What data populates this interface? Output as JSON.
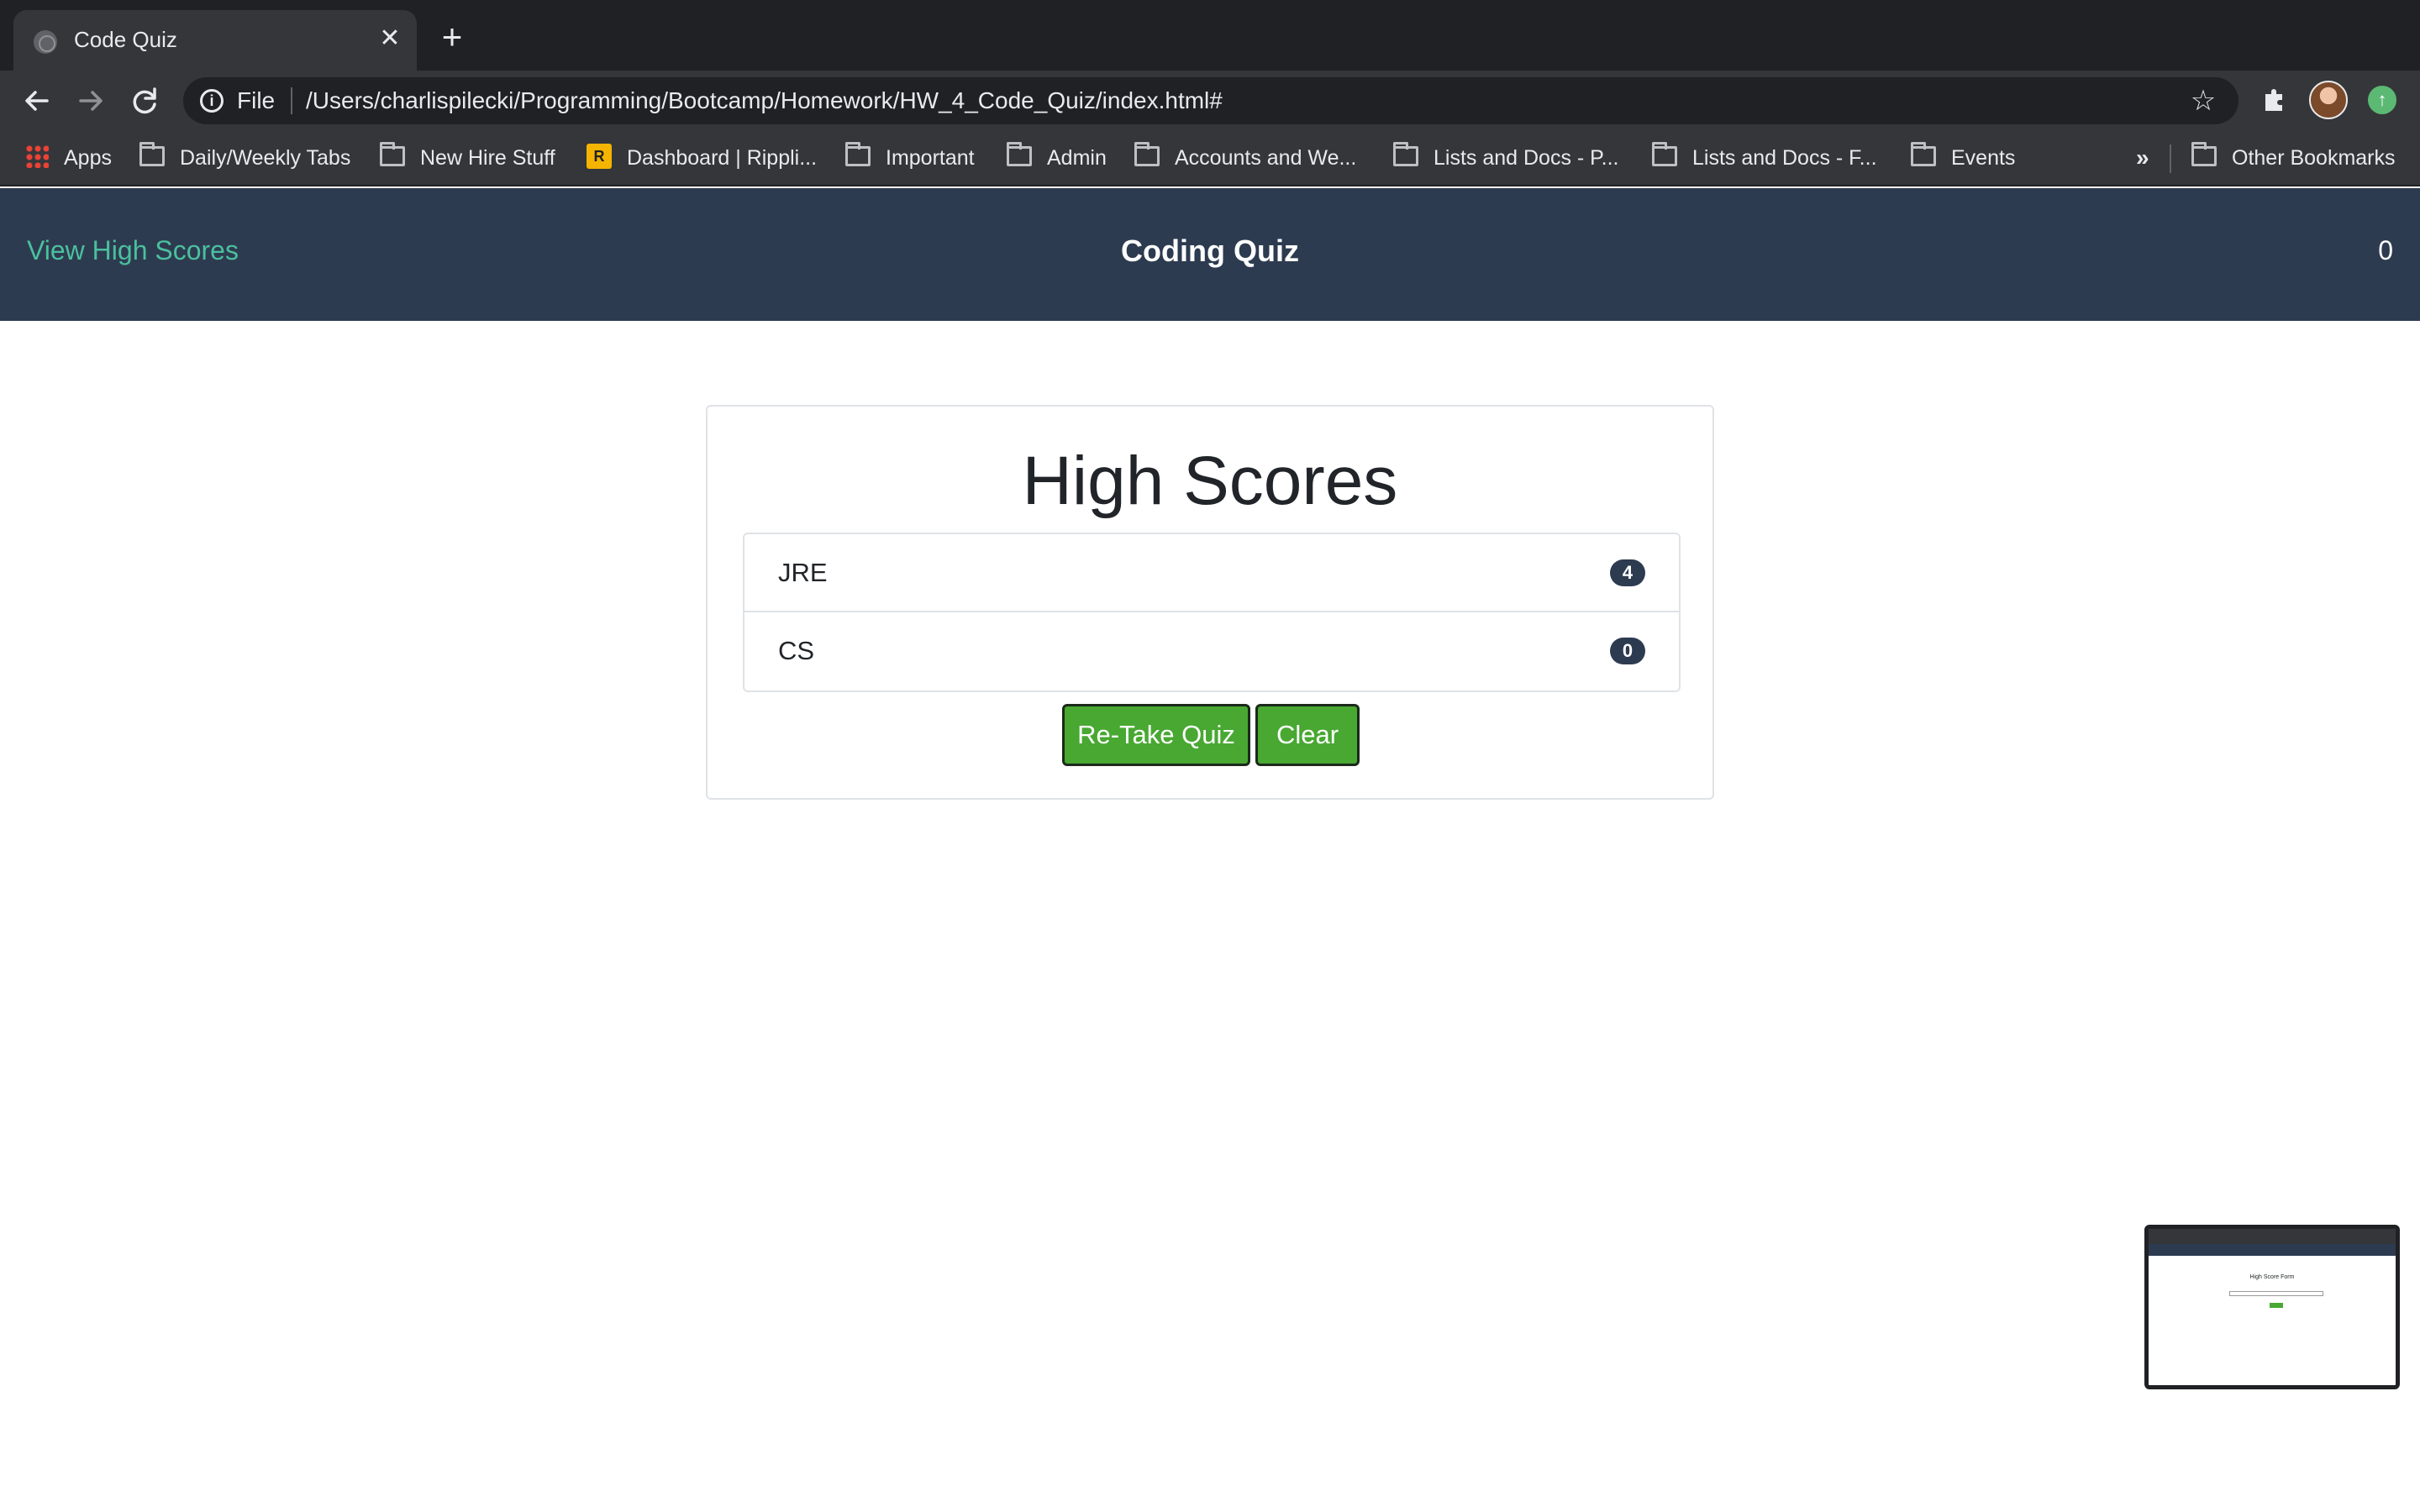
{
  "browser": {
    "tab_title": "Code Quiz",
    "tab_close": "✕",
    "new_tab": "+",
    "file_label": "File",
    "url": "/Users/charlispilecki/Programming/Bootcamp/Homework/HW_4_Code_Quiz/index.html#",
    "bookmarks": [
      "Apps",
      "Daily/Weekly Tabs",
      "New Hire Stuff",
      "Dashboard | Rippli...",
      "Important",
      "Admin",
      "Accounts and We...",
      "Lists and Docs - P...",
      "Lists and Docs - F...",
      "Events"
    ],
    "more_bookmarks": "»",
    "other_bookmarks": "Other Bookmarks"
  },
  "header": {
    "view_high_scores": "View High Scores",
    "title": "Coding Quiz",
    "timer": "0"
  },
  "high_scores": {
    "title": "High Scores",
    "entries": [
      {
        "name": "JRE",
        "score": "4"
      },
      {
        "name": "CS",
        "score": "0"
      }
    ],
    "retake_label": "Re-Take Quiz",
    "clear_label": "Clear"
  },
  "thumbnail": {
    "title": "High Score Form"
  },
  "colors": {
    "header_bg": "#2d3b50",
    "link": "#4bbf9e",
    "button_bg": "#48a832",
    "badge_bg": "#2d3b50"
  }
}
